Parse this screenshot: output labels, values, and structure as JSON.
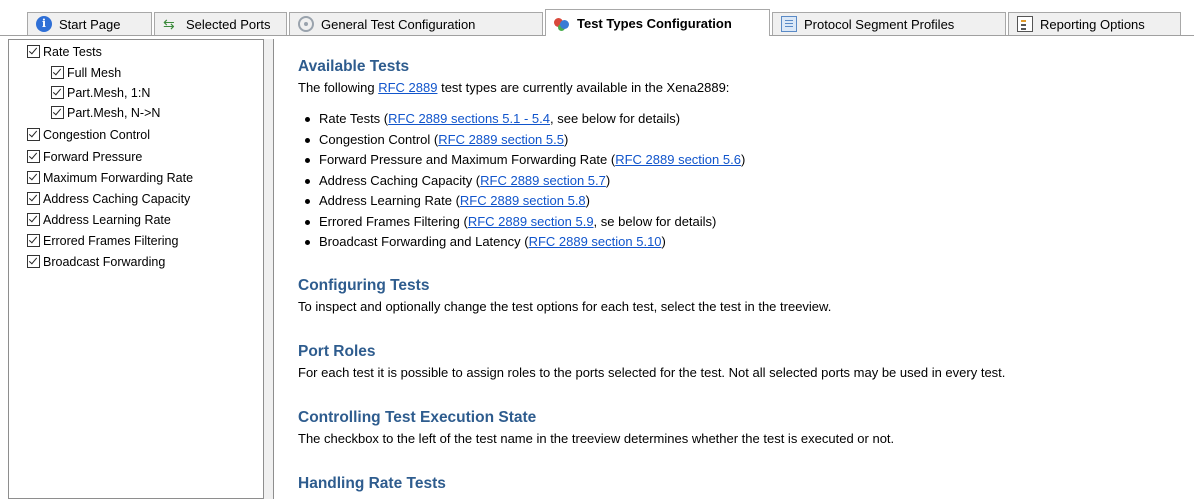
{
  "tabs": [
    {
      "label": "Start Page",
      "icon": "info-icon"
    },
    {
      "label": "Selected Ports",
      "icon": "ports-icon"
    },
    {
      "label": "General Test Configuration",
      "icon": "gear-icon"
    },
    {
      "label": "Test Types Configuration",
      "icon": "test-types-icon",
      "active": true
    },
    {
      "label": "Protocol Segment Profiles",
      "icon": "document-icon"
    },
    {
      "label": "Reporting Options",
      "icon": "report-icon"
    }
  ],
  "tree": {
    "items": [
      {
        "label": "Rate Tests",
        "checked": true,
        "level": 0
      },
      {
        "label": "Full Mesh",
        "checked": true,
        "level": 1
      },
      {
        "label": "Part.Mesh, 1:N",
        "checked": true,
        "level": 1
      },
      {
        "label": "Part.Mesh, N->N",
        "checked": true,
        "level": 1
      },
      {
        "label": "Congestion Control",
        "checked": true,
        "level": 0
      },
      {
        "label": "Forward Pressure",
        "checked": true,
        "level": 0
      },
      {
        "label": "Maximum Forwarding Rate",
        "checked": true,
        "level": 0
      },
      {
        "label": "Address Caching Capacity",
        "checked": true,
        "level": 0
      },
      {
        "label": "Address Learning Rate",
        "checked": true,
        "level": 0
      },
      {
        "label": "Errored Frames Filtering",
        "checked": true,
        "level": 0
      },
      {
        "label": "Broadcast Forwarding",
        "checked": true,
        "level": 0
      }
    ]
  },
  "content": {
    "available_tests": {
      "heading": "Available Tests",
      "intro_prefix": "The following ",
      "intro_link": "RFC 2889",
      "intro_suffix": " test types are currently available in the Xena2889:",
      "bullets": [
        {
          "text": "Rate Tests (",
          "link": "RFC 2889 sections 5.1 - 5.4",
          "after": ", see below for details)"
        },
        {
          "text": "Congestion Control (",
          "link": "RFC 2889 section 5.5",
          "after": ")"
        },
        {
          "text": "Forward Pressure and Maximum Forwarding Rate (",
          "link": "RFC 2889 section 5.6",
          "after": ")"
        },
        {
          "text": "Address Caching Capacity (",
          "link": "RFC 2889 section 5.7",
          "after": ")"
        },
        {
          "text": "Address Learning Rate (",
          "link": "RFC 2889 section 5.8",
          "after": ")"
        },
        {
          "text": "Errored Frames Filtering (",
          "link": "RFC 2889 section 5.9",
          "after": ", se below for details)"
        },
        {
          "text": "Broadcast Forwarding and Latency (",
          "link": "RFC 2889 section 5.10",
          "after": ")"
        }
      ]
    },
    "configuring_tests": {
      "heading": "Configuring Tests",
      "text": "To inspect and optionally change the test options for each test, select the test in the treeview."
    },
    "port_roles": {
      "heading": "Port Roles",
      "text": "For each test it is possible to assign roles to the ports selected for the test. Not all selected ports may be used in every test."
    },
    "controlling_state": {
      "heading": "Controlling Test Execution State",
      "text": "The checkbox to the left of the test name in the treeview determines whether the test is executed or not."
    },
    "handling_rate_tests": {
      "heading": "Handling Rate Tests"
    }
  },
  "colors": {
    "heading": "#2e5c8e",
    "link": "#1155cc"
  }
}
